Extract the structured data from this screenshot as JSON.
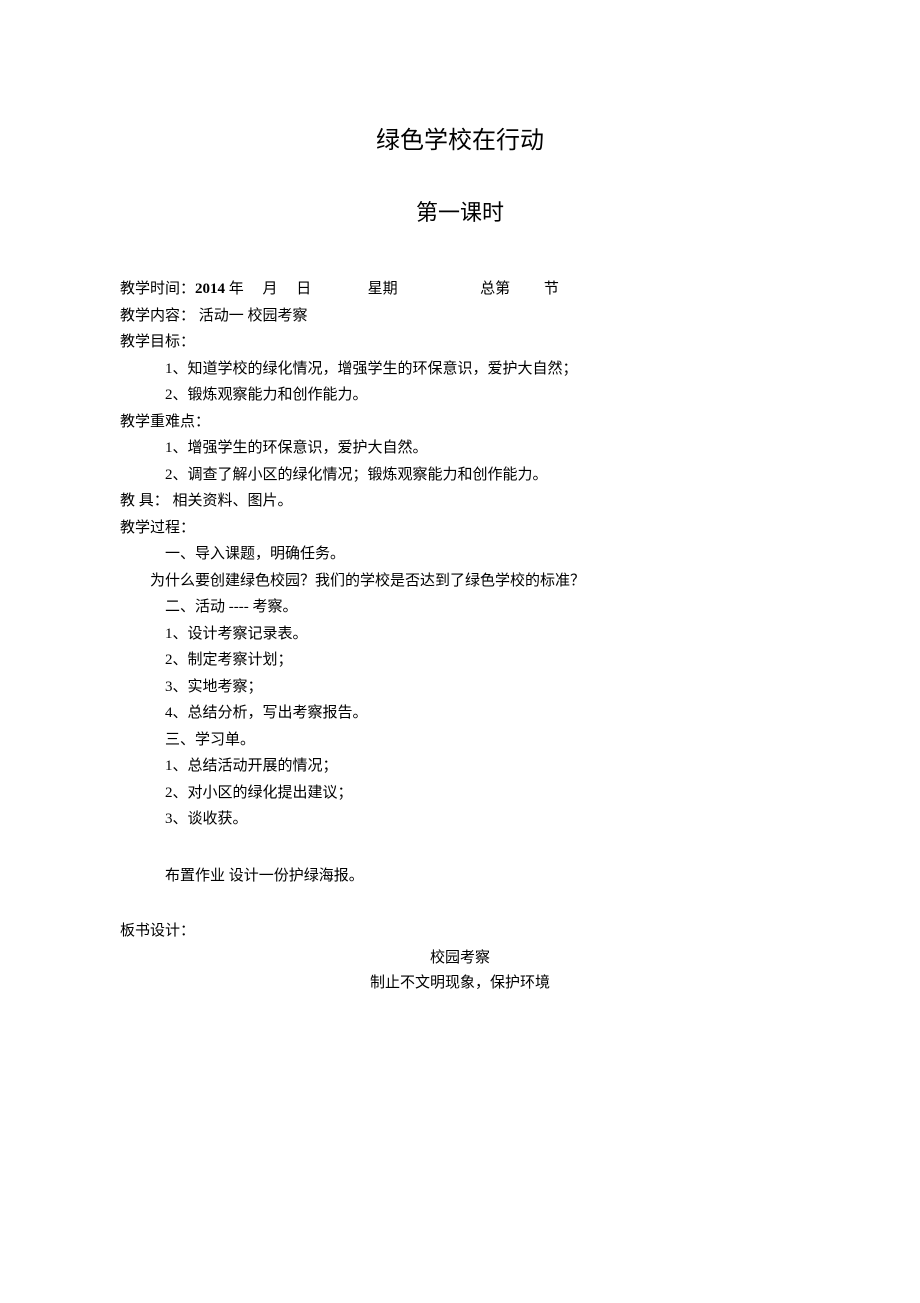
{
  "title_main": "绿色学校在行动",
  "title_sub": "第一课时",
  "time_line": {
    "label": "教学时间：",
    "year": "2014",
    "year_suffix": " 年",
    "month_gap": "     ",
    "month_suffix": "月",
    "day_gap": "     ",
    "day_suffix": "日",
    "week_gap": "               ",
    "week": "星期",
    "total_gap": "                      ",
    "total_prefix": "总第",
    "section_gap": "         ",
    "section_suffix": "节"
  },
  "content_label": "教学内容：",
  "content_text": "   活动一    校园考察",
  "goal_label": "教学目标：",
  "goals": [
    "1、知道学校的绿化情况，增强学生的环保意识，爱护大自然；",
    "2、锻炼观察能力和创作能力。"
  ],
  "difficulty_label": "教学重难点：",
  "difficulties": [
    "1、增强学生的环保意识，爱护大自然。",
    "2、调查了解小区的绿化情况；锻炼观察能力和创作能力。"
  ],
  "tools_label": "教  具：",
  "tools_text": "相关资料、图片。",
  "process_label": "教学过程：",
  "process_items": [
    "一、导入课题，明确任务。",
    "为什么要创建绿色校园？我们的学校是否达到了绿色学校的标准？",
    "二、活动 ---- 考察。",
    "1、设计考察记录表。",
    "2、制定考察计划；",
    "3、实地考察；",
    "4、总结分析，写出考察报告。",
    "三、学习单。",
    "1、总结活动开展的情况；",
    "2、对小区的绿化提出建议；",
    "3、谈收获。"
  ],
  "homework": "布置作业    设计一份护绿海报。",
  "board_label": "板书设计：",
  "board_title": "校园考察",
  "board_content": "制止不文明现象，保护环境"
}
